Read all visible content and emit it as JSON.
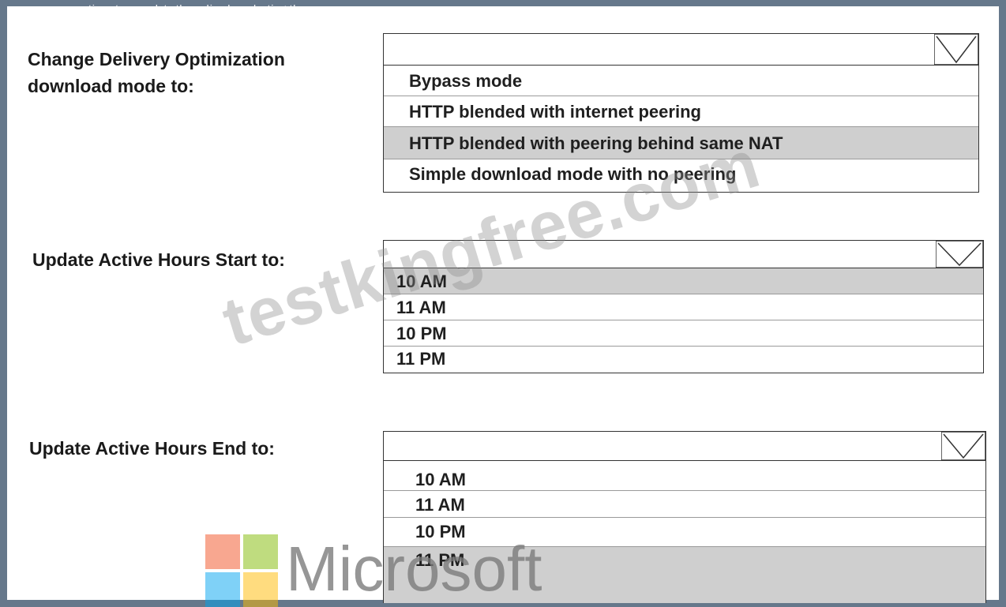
{
  "header": {
    "clipped_text": "answer options to complete the policy by selecting the..."
  },
  "settings": [
    {
      "label_line1": "Change Delivery Optimization",
      "label_line2": "download mode to:",
      "options": [
        "Bypass mode",
        "HTTP blended with internet peering",
        "HTTP blended with peering behind same NAT",
        "Simple download mode with no peering"
      ],
      "selected_index": 2
    },
    {
      "label": "Update Active Hours Start to:",
      "options": [
        "10 AM",
        "11 AM",
        "10 PM",
        "11 PM"
      ],
      "selected_index": 0
    },
    {
      "label": "Update Active Hours End to:",
      "options": [
        "10 AM",
        "11 AM",
        "10 PM",
        "11 PM"
      ],
      "selected_index": 3
    }
  ],
  "watermark": "testkingfree.com",
  "brand": {
    "name": "Microsoft",
    "colors": {
      "red": "#f25022",
      "green": "#7fba00",
      "blue": "#00a4ef",
      "yellow": "#ffb900"
    }
  },
  "colors": {
    "frame": "#66788b",
    "selection": "#cfcfcf"
  }
}
